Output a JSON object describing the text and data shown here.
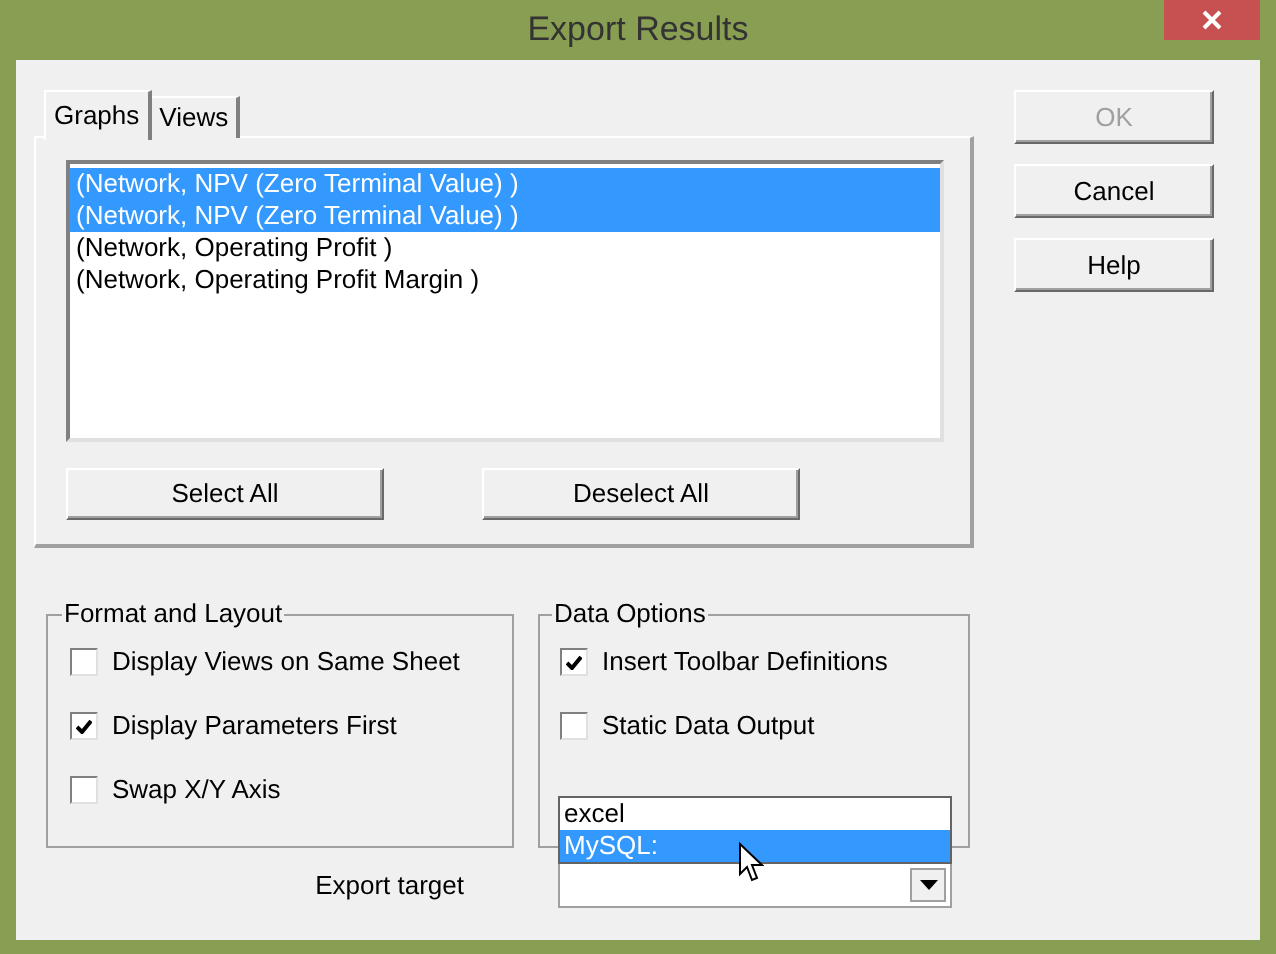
{
  "window": {
    "title": "Export Results"
  },
  "tabs": [
    {
      "label": "Graphs",
      "selected": true
    },
    {
      "label": "Views",
      "selected": false
    }
  ],
  "list": {
    "items": [
      {
        "label": "(Network, NPV (Zero Terminal Value) )",
        "selected": true
      },
      {
        "label": "(Network, NPV (Zero Terminal Value) )",
        "selected": true
      },
      {
        "label": "(Network, Operating Profit )",
        "selected": false
      },
      {
        "label": "(Network, Operating Profit Margin )",
        "selected": false
      }
    ]
  },
  "list_buttons": [
    "Select All",
    "Deselect All"
  ],
  "dialog_buttons": [
    {
      "label": "OK",
      "disabled": true
    },
    {
      "label": "Cancel",
      "disabled": false
    },
    {
      "label": "Help",
      "disabled": false
    }
  ],
  "format_and_layout": {
    "title": "Format and Layout",
    "options": [
      {
        "label": "Display Views on Same Sheet",
        "checked": false
      },
      {
        "label": "Display Parameters First",
        "checked": true
      },
      {
        "label": "Swap X/Y Axis",
        "checked": false
      }
    ]
  },
  "data_options": {
    "title": "Data Options",
    "options": [
      {
        "label": "Insert Toolbar Definitions",
        "checked": true
      },
      {
        "label": "Static Data Output",
        "checked": false
      }
    ]
  },
  "export_target": {
    "label": "Export target",
    "dropdown": [
      {
        "label": "excel",
        "selected": false
      },
      {
        "label": "MySQL:",
        "selected": true
      }
    ]
  }
}
